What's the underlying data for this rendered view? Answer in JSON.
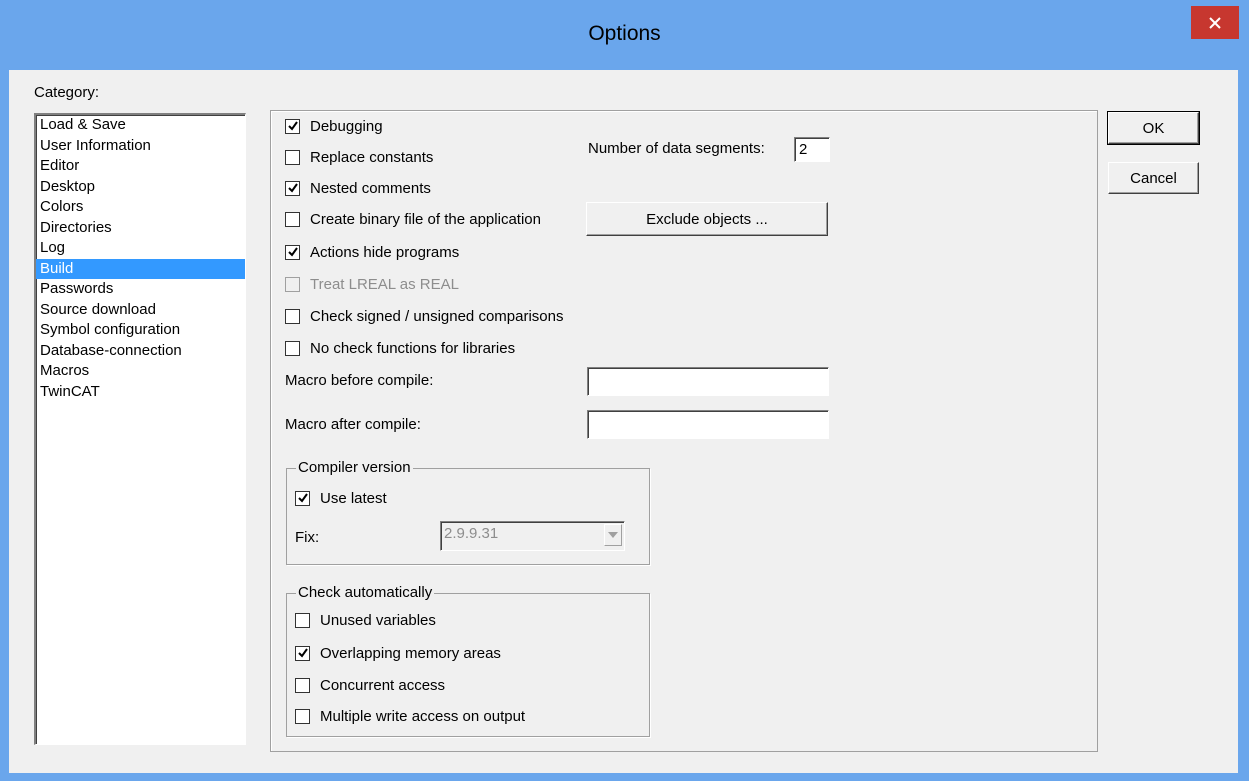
{
  "window": {
    "title": "Options"
  },
  "category": {
    "label": "Category:",
    "items": [
      "Load & Save",
      "User Information",
      "Editor",
      "Desktop",
      "Colors",
      "Directories",
      "Log",
      "Build",
      "Passwords",
      "Source download",
      "Symbol configuration",
      "Database-connection",
      "Macros",
      "TwinCAT"
    ],
    "selected": "Build"
  },
  "build": {
    "debugging": {
      "label": "Debugging",
      "checked": true
    },
    "replace_constants": {
      "label": "Replace constants",
      "checked": false
    },
    "nested_comments": {
      "label": "Nested comments",
      "checked": true
    },
    "create_binary": {
      "label": "Create binary file of the application",
      "checked": false
    },
    "actions_hide": {
      "label": "Actions hide programs",
      "checked": true
    },
    "treat_lreal": {
      "label": "Treat LREAL as REAL",
      "checked": false,
      "disabled": true
    },
    "check_signed": {
      "label": "Check signed / unsigned comparisons",
      "checked": false
    },
    "no_check_functions": {
      "label": "No check functions for libraries",
      "checked": false
    },
    "data_segments_label": "Number of data segments:",
    "data_segments_value": "2",
    "exclude_objects_label": "Exclude objects ...",
    "macro_before_label": "Macro before compile:",
    "macro_before_value": "",
    "macro_after_label": "Macro after compile:",
    "macro_after_value": ""
  },
  "compiler": {
    "title": "Compiler version",
    "use_latest": {
      "label": "Use latest",
      "checked": true
    },
    "fix_label": "Fix:",
    "fix_value": "2.9.9.31"
  },
  "check_auto": {
    "title": "Check automatically",
    "unused": {
      "label": "Unused variables",
      "checked": false
    },
    "overlapping": {
      "label": "Overlapping memory areas",
      "checked": true
    },
    "concurrent": {
      "label": "Concurrent access",
      "checked": false
    },
    "multiple_write": {
      "label": "Multiple write access on output",
      "checked": false
    }
  },
  "buttons": {
    "ok": "OK",
    "cancel": "Cancel"
  },
  "icons": {
    "close": "close-icon",
    "check": "checkmark-icon",
    "dropdown": "chevron-down-icon"
  },
  "colors": {
    "titlebar": "#6aa6ec",
    "close": "#c7372f",
    "selection": "#3399ff",
    "dialog": "#f0f0f0"
  }
}
